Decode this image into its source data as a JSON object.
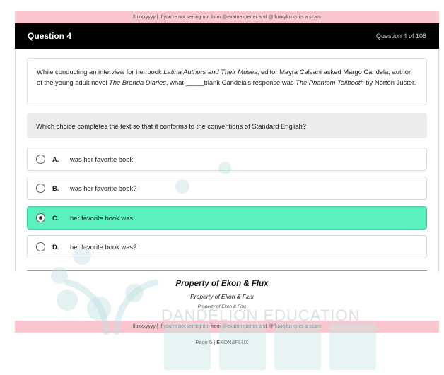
{
  "banner": {
    "text": "fluxxxyyyy | If you're not seeing not from @examexperter and @fluxxyluxxy its a scam"
  },
  "header": {
    "title": "Question 4",
    "counter": "Question 4 of 108"
  },
  "passage": {
    "text_1": "While conducting an interview for her book ",
    "book_title": "Latina Authors and Their Muses",
    "text_2": ", editor Mayra Calvani asked Margo Candela, author of the young adult novel ",
    "novel_title": "The Brenda Diaries",
    "text_3": ", what _____blank Candela's response was ",
    "answer_title": "The Phantom Tollbooth",
    "text_4": " by Norton Juster."
  },
  "prompt": "Which choice completes the text so that it conforms to the conventions of Standard English?",
  "choices": [
    {
      "letter": "A.",
      "text": "was her favorite book!",
      "selected": false
    },
    {
      "letter": "B.",
      "text": "was her favorite book?",
      "selected": false
    },
    {
      "letter": "C.",
      "text": "her favorite book was.",
      "selected": true
    },
    {
      "letter": "D.",
      "text": "her favorite book was?",
      "selected": false
    }
  ],
  "property": {
    "line_1": "Property of Ekon & Flux",
    "line_2": "Property of Ekon & Flux",
    "line_3": "Property of Ekon & Flux"
  },
  "footer": "Page 5 | EKON&FLUX",
  "watermark_text": "DANDELION EDUCATION",
  "colors": {
    "banner": "#f9c6d0",
    "header": "#000000",
    "selected_choice": "#5cf0c0",
    "prompt_bg": "#ececec"
  }
}
